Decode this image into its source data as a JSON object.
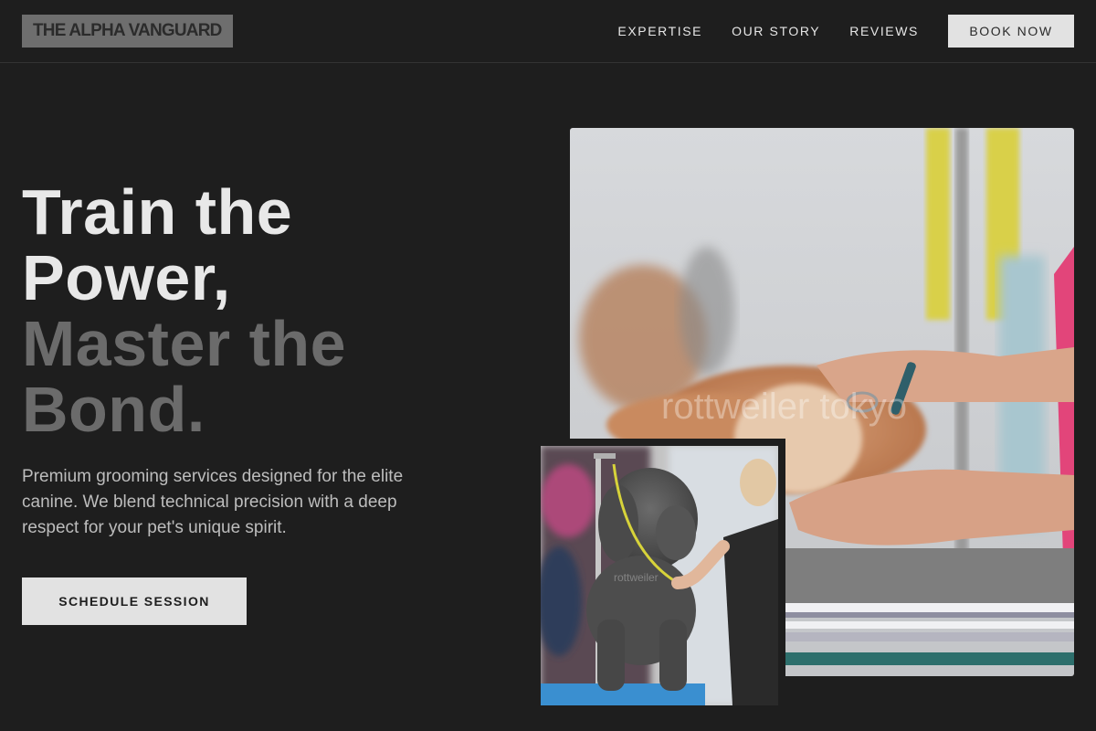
{
  "header": {
    "logo": "THE ALPHA VANGUARD",
    "nav": [
      "EXPERTISE",
      "OUR STORY",
      "REVIEWS"
    ],
    "cta": "BOOK NOW"
  },
  "hero": {
    "headline_light": [
      "Train the",
      "Power,"
    ],
    "headline_dim": [
      "Master the",
      "Bond."
    ],
    "description": "Premium grooming services designed for the elite canine. We blend technical precision with a deep respect for your pet's unique spirit.",
    "cta": "SCHEDULE SESSION"
  },
  "images": {
    "main_watermark": "rottweiler tokyo",
    "small_watermark": "rottweiler"
  },
  "colors": {
    "background": "#1e1e1e",
    "headline_light": "#e8e8e8",
    "headline_dim": "#6b6b6b",
    "button": "#e2e2e2"
  }
}
